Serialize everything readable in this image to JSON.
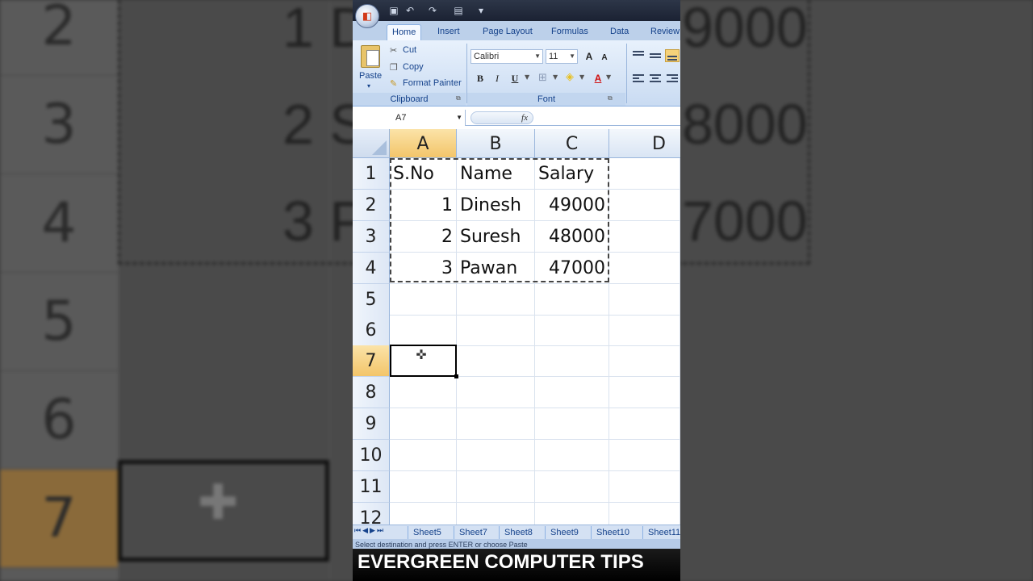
{
  "ribbon": {
    "tabs": [
      "Home",
      "Insert",
      "Page Layout",
      "Formulas",
      "Data",
      "Review"
    ],
    "clipboard": {
      "paste": "Paste",
      "cut": "Cut",
      "copy": "Copy",
      "format_painter": "Format Painter",
      "group_label": "Clipboard"
    },
    "font": {
      "name": "Calibri",
      "size": "11",
      "bold": "B",
      "italic": "I",
      "underline": "U",
      "grow": "A",
      "shrink": "A",
      "group_label": "Font",
      "font_color_glyph": "A"
    }
  },
  "formula_bar": {
    "name_box": "A7",
    "fx": "fx"
  },
  "grid": {
    "columns": [
      "A",
      "B",
      "C",
      "D"
    ],
    "rows": [
      "1",
      "2",
      "3",
      "4",
      "5",
      "6",
      "7",
      "8",
      "9",
      "10",
      "11",
      "12"
    ],
    "cells": [
      [
        "S.No",
        "Name",
        "Salary"
      ],
      [
        "1",
        "Dinesh",
        "49000"
      ],
      [
        "2",
        "Suresh",
        "48000"
      ],
      [
        "3",
        "Pawan",
        "47000"
      ]
    ],
    "selected_cell": "A7"
  },
  "sheet_tabs": [
    "Sheet5",
    "Sheet7",
    "Sheet8",
    "Sheet9",
    "Sheet10",
    "Sheet11"
  ],
  "status_text": "Select destination and press ENTER or choose Paste",
  "banner_text": "EVERGREEN COMPUTER TIPS",
  "background": {
    "rows": [
      "2",
      "3",
      "4",
      "5",
      "6",
      "7"
    ],
    "texts": [
      "1 D",
      "2 S",
      "3 P",
      "9000",
      "8000",
      "7000"
    ]
  },
  "colors": {
    "selection_header": "#f3c56a",
    "ribbon": "#c9dbf2",
    "title": "#1b2233"
  }
}
